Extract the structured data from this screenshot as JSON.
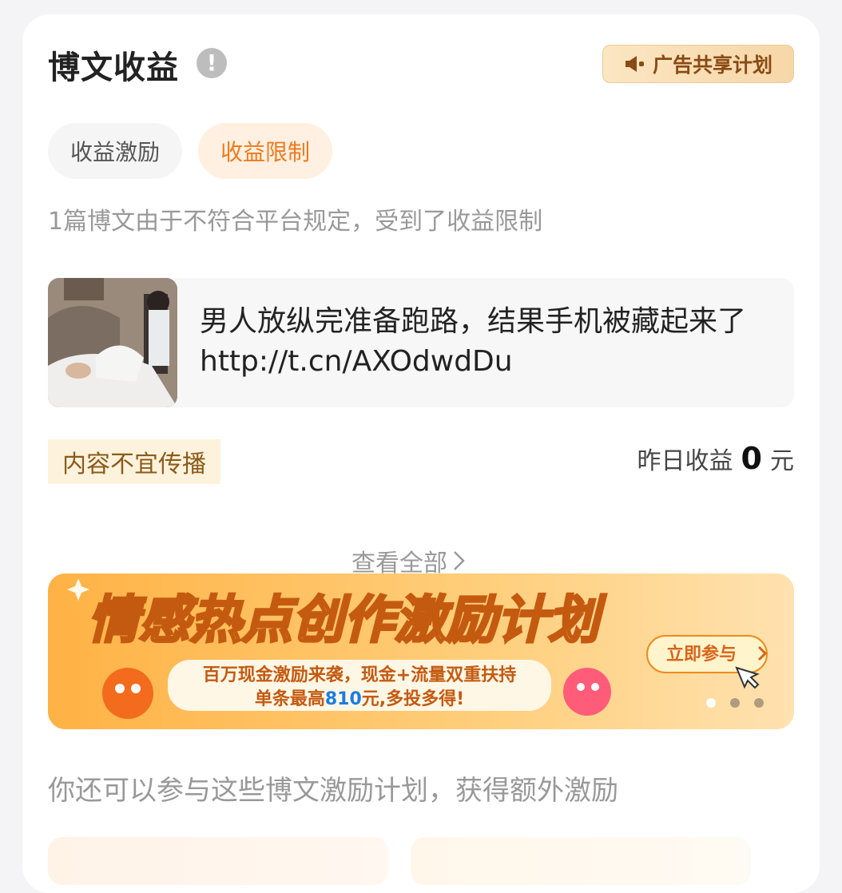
{
  "header": {
    "title": "博文收益",
    "info_icon": "!",
    "ad_share_label": "广告共享计划",
    "ad_share_icon": "megaphone-icon"
  },
  "tabs": [
    {
      "label": "收益激励",
      "active": false
    },
    {
      "label": "收益限制",
      "active": true
    }
  ],
  "notice": "1篇博文由于不符合平台规定，受到了收益限制",
  "post": {
    "text": "男人放纵完准备跑路，结果手机被藏起来了 http://t.cn/AXOdwdDu",
    "restriction_tag": "内容不宜传播",
    "yesterday_label": "昨日收益",
    "yesterday_value": "0",
    "yesterday_unit": "元"
  },
  "view_all": "查看全部",
  "banner": {
    "title": "情感热点创作激励计划",
    "subtitle_line1": "百万现金激励来袭，现金+流量双重扶持",
    "subtitle_line2_pre": "单条最高",
    "subtitle_line2_amount": "810",
    "subtitle_line2_post": "元,多投多得!",
    "cta": "立即参与",
    "carousel_dots": 3,
    "active_dot": 0
  },
  "extra_text": "你还可以参与这些博文激励计划，获得额外激励",
  "colors": {
    "accent": "#f07a1c",
    "banner_title_yellow": "#ffe23a",
    "banner_amount_blue": "#1d7ce0"
  }
}
